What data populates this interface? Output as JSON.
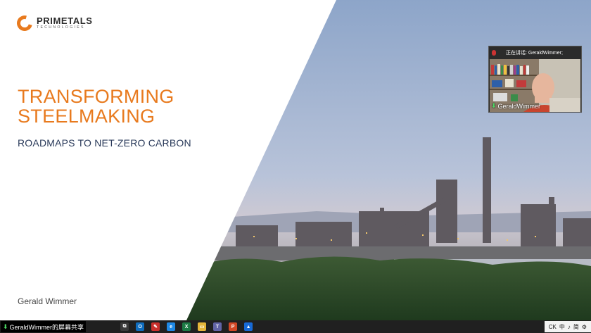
{
  "slide": {
    "logo": {
      "name": "PRIMETALS",
      "subtitle": "TECHNOLOGIES"
    },
    "title_line1": "TRANSFORMING",
    "title_line2": "STEELMAKING",
    "subtitle": "ROADMAPS TO NET-ZERO CARBON",
    "presenter": "Gerald Wimmer"
  },
  "video": {
    "speaking_label": "正在讲话: GeraldWimmer;",
    "participant_name": "GeraldWimmer"
  },
  "taskbar": {
    "share_label": "GeraldWimmer的屏幕共享",
    "apps": [
      {
        "name": "task-view",
        "color": "#3a3a3a",
        "glyph": "⧉"
      },
      {
        "name": "outlook",
        "color": "#0f6cbd",
        "glyph": "O"
      },
      {
        "name": "edge-dev",
        "color": "#c9302c",
        "glyph": "✎"
      },
      {
        "name": "edge",
        "color": "#1e88e5",
        "glyph": "e"
      },
      {
        "name": "excel",
        "color": "#1d7a45",
        "glyph": "X"
      },
      {
        "name": "file-explorer",
        "color": "#e5b53a",
        "glyph": "▭"
      },
      {
        "name": "teams",
        "color": "#6264a7",
        "glyph": "T"
      },
      {
        "name": "powerpoint",
        "color": "#d24726",
        "glyph": "P"
      },
      {
        "name": "meeting-app",
        "color": "#1769d6",
        "glyph": "▲"
      }
    ],
    "tray": [
      "CK",
      "中",
      "简"
    ]
  },
  "colors": {
    "accent": "#e87a1e",
    "subtitle": "#2a3a5a"
  }
}
